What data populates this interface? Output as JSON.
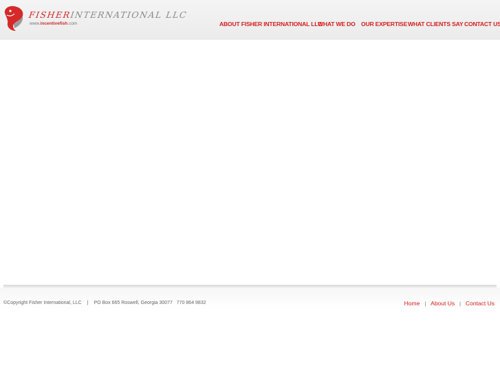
{
  "logo": {
    "name_part1": "FISHER",
    "name_part2": "INTERNATIONAL LLC",
    "url_prefix": "www.",
    "url_bold": "incentivefish",
    "url_suffix": ".com",
    "icon": "red-fish-logo-icon"
  },
  "nav": [
    {
      "label": "ABOUT FISHER INTERNATIONAL LLC"
    },
    {
      "label": "WHAT WE DO"
    },
    {
      "label": "OUR EXPERTISE"
    },
    {
      "label": "WHAT CLIENTS SAY"
    },
    {
      "label": "CONTACT US"
    }
  ],
  "footer": {
    "copyright": "©Copyright Fisher International, LLC",
    "separator": "|",
    "address": "PO Box 665 Roswell, Georgia 30077   770 864 9832",
    "links": [
      {
        "label": "Home"
      },
      {
        "label": "About Us"
      },
      {
        "label": "Contact Us"
      }
    ],
    "link_separator": "|"
  },
  "colors": {
    "brand_red": "#d41e1e",
    "header_bg": "#efefef"
  }
}
